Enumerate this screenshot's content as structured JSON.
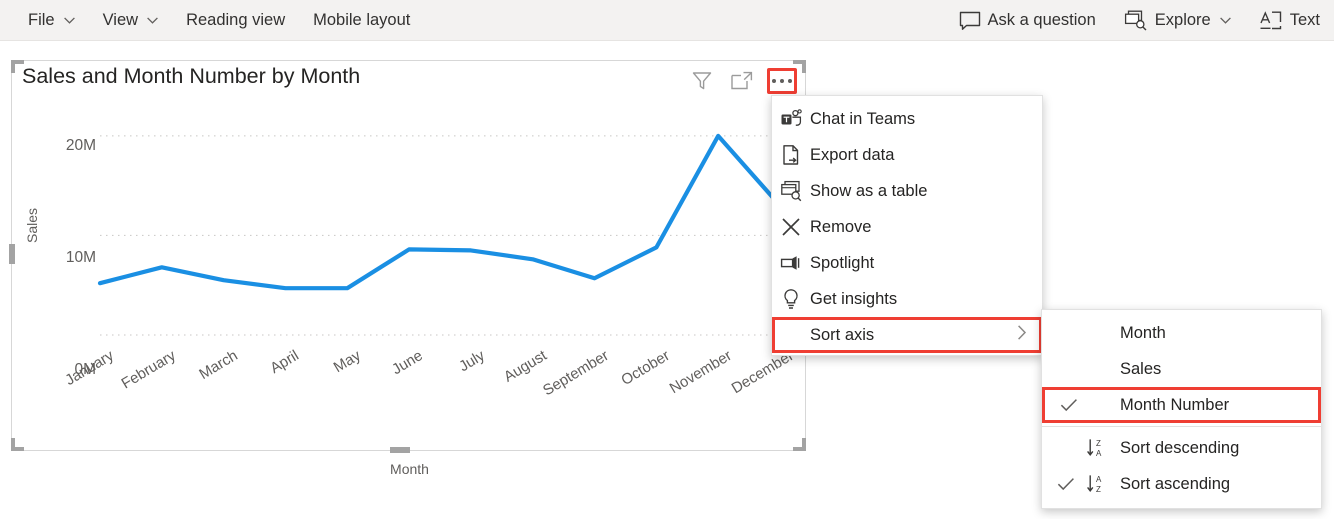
{
  "ribbon": {
    "left_items": [
      {
        "label": "File",
        "icon": "chevron-down-icon",
        "has_chevron": true
      },
      {
        "label": "View",
        "icon": "chevron-down-icon",
        "has_chevron": true
      },
      {
        "label": "Reading view",
        "has_chevron": false
      },
      {
        "label": "Mobile layout",
        "has_chevron": false
      }
    ],
    "right_items": [
      {
        "label": "Ask a question",
        "icon": "chat-bubble-icon",
        "has_chevron": false
      },
      {
        "label": "Explore",
        "icon": "explore-icon",
        "has_chevron": true
      },
      {
        "label": "Text",
        "icon": "text-box-icon",
        "has_chevron": false
      }
    ]
  },
  "visual": {
    "title": "Sales and Month Number by Month",
    "header_icons": [
      {
        "name": "filter-icon",
        "label": "Filters",
        "active": false
      },
      {
        "name": "focus-mode-icon",
        "label": "Focus mode",
        "active": false
      },
      {
        "name": "more-options-icon",
        "label": "More options",
        "active": true
      }
    ]
  },
  "context_menu": {
    "items": [
      {
        "label": "Chat in Teams",
        "icon": "teams-icon",
        "highlighted": false,
        "submenu": false
      },
      {
        "label": "Export data",
        "icon": "export-data-icon",
        "highlighted": false,
        "submenu": false
      },
      {
        "label": "Show as a table",
        "icon": "show-as-table-icon",
        "highlighted": false,
        "submenu": false
      },
      {
        "label": "Remove",
        "icon": "remove-x-icon",
        "highlighted": false,
        "submenu": false
      },
      {
        "label": "Spotlight",
        "icon": "spotlight-icon",
        "highlighted": false,
        "submenu": false
      },
      {
        "label": "Get insights",
        "icon": "lightbulb-icon",
        "highlighted": false,
        "submenu": false
      },
      {
        "label": "Sort axis",
        "icon": "",
        "highlighted": true,
        "submenu": true
      }
    ]
  },
  "sub_menu": {
    "items": [
      {
        "label": "Month",
        "checked": false,
        "icon": "",
        "highlighted": false,
        "divider_after": false
      },
      {
        "label": "Sales",
        "checked": false,
        "icon": "",
        "highlighted": false,
        "divider_after": false
      },
      {
        "label": "Month Number",
        "checked": true,
        "icon": "",
        "highlighted": true,
        "divider_after": true
      },
      {
        "label": "Sort descending",
        "checked": false,
        "icon": "sort-descending-icon",
        "highlighted": false,
        "divider_after": false
      },
      {
        "label": "Sort ascending",
        "checked": true,
        "icon": "sort-ascending-icon",
        "highlighted": false,
        "divider_after": false
      }
    ]
  },
  "colors": {
    "line": "#1a8fe3",
    "highlight": "#ef3e33",
    "ribbon_bg": "#f3f2f1",
    "axis_text": "#605e5c",
    "title_text": "#252423"
  },
  "chart_data": {
    "type": "line",
    "title": "Sales and Month Number by Month",
    "xlabel": "Month",
    "ylabel": "Sales",
    "categories": [
      "January",
      "February",
      "March",
      "April",
      "May",
      "June",
      "July",
      "August",
      "September",
      "October",
      "November",
      "December"
    ],
    "series": [
      {
        "name": "Sales",
        "values": [
          5.2,
          6.8,
          5.5,
          4.7,
          4.7,
          8.6,
          8.5,
          7.6,
          5.7,
          8.8,
          20.0,
          13.0
        ]
      }
    ],
    "value_suffix": "M",
    "ylim": [
      0,
      22.5
    ],
    "yticks": [
      0,
      10,
      20
    ],
    "ytick_labels": [
      "0M",
      "10M",
      "20M"
    ],
    "grid": true,
    "legend": "none"
  }
}
